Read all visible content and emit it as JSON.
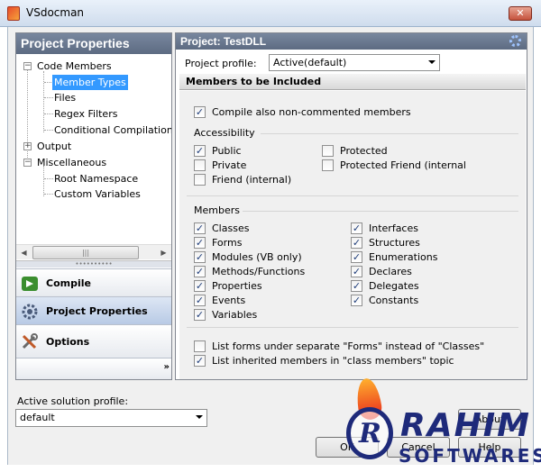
{
  "window": {
    "title": "VSdocman",
    "close_label": "✕"
  },
  "left_panel": {
    "header": "Project Properties",
    "tree": {
      "code_members": "Code Members",
      "member_types": "Member Types",
      "files": "Files",
      "regex_filters": "Regex Filters",
      "conditional_compilation": "Conditional Compilation",
      "output": "Output",
      "miscellaneous": "Miscellaneous",
      "root_namespace": "Root Namespace",
      "custom_variables": "Custom Variables"
    },
    "nav": {
      "compile": "Compile",
      "project_properties": "Project Properties",
      "options": "Options",
      "more": "»"
    }
  },
  "right_panel": {
    "header": "Project: TestDLL",
    "profile_label": "Project profile:",
    "profile_value": "Active(default)",
    "section_title": "Members to be Included",
    "compile_non_commented": "Compile also non-commented members",
    "accessibility": {
      "title": "Accessibility",
      "public": "Public",
      "private": "Private",
      "friend": "Friend (internal)",
      "protected": "Protected",
      "protected_friend": "Protected Friend (internal"
    },
    "members": {
      "title": "Members",
      "classes": "Classes",
      "forms": "Forms",
      "modules": "Modules (VB only)",
      "methods": "Methods/Functions",
      "properties": "Properties",
      "events": "Events",
      "variables": "Variables",
      "interfaces": "Interfaces",
      "structures": "Structures",
      "enumerations": "Enumerations",
      "declares": "Declares",
      "delegates": "Delegates",
      "constants": "Constants"
    },
    "list_forms_separate": "List forms under separate \"Forms\" instead of \"Classes\"",
    "list_inherited": "List inherited members in \"class members\" topic"
  },
  "bottom": {
    "solution_label": "Active solution profile:",
    "solution_value": "default",
    "about_button": "About",
    "ok_button": "OK",
    "cancel_button": "Cancel",
    "help_button": "Help"
  },
  "checks": {
    "checked_glyph": "✓"
  },
  "watermark": {
    "line1": "RAHIM",
    "line2": "SOFTWARES",
    "emblem": "R"
  }
}
